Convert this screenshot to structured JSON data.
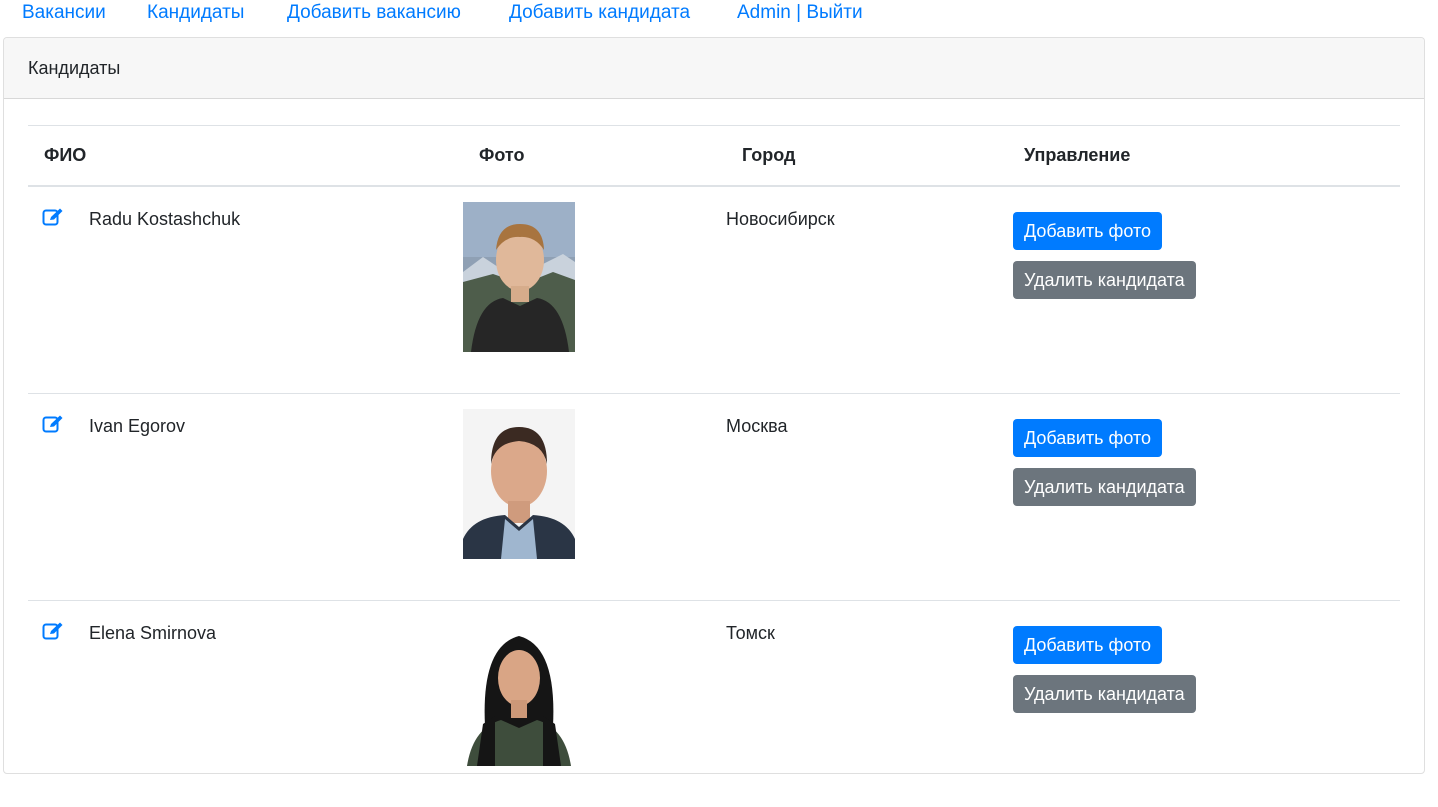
{
  "nav": {
    "vacancies": "Вакансии",
    "candidates": "Кандидаты",
    "add_vacancy": "Добавить вакансию",
    "add_candidate": "Добавить кандидата",
    "user": "Admin | Выйти"
  },
  "card": {
    "title": "Кандидаты"
  },
  "table": {
    "headers": {
      "name": "ФИО",
      "photo": "Фото",
      "city": "Город",
      "actions": "Управление"
    },
    "rows": [
      {
        "name": "Radu Kostashchuk",
        "city": "Новосибирск",
        "add_photo": "Добавить фото",
        "delete": "Удалить кандидата"
      },
      {
        "name": "Ivan Egorov",
        "city": "Москва",
        "add_photo": "Добавить фото",
        "delete": "Удалить кандидата"
      },
      {
        "name": "Elena Smirnova",
        "city": "Томск",
        "add_photo": "Добавить фото",
        "delete": "Удалить кандидата"
      }
    ]
  },
  "colors": {
    "link": "#007bff",
    "primary": "#007bff",
    "secondary": "#6c757d"
  },
  "icons": {
    "edit": "edit-icon"
  }
}
